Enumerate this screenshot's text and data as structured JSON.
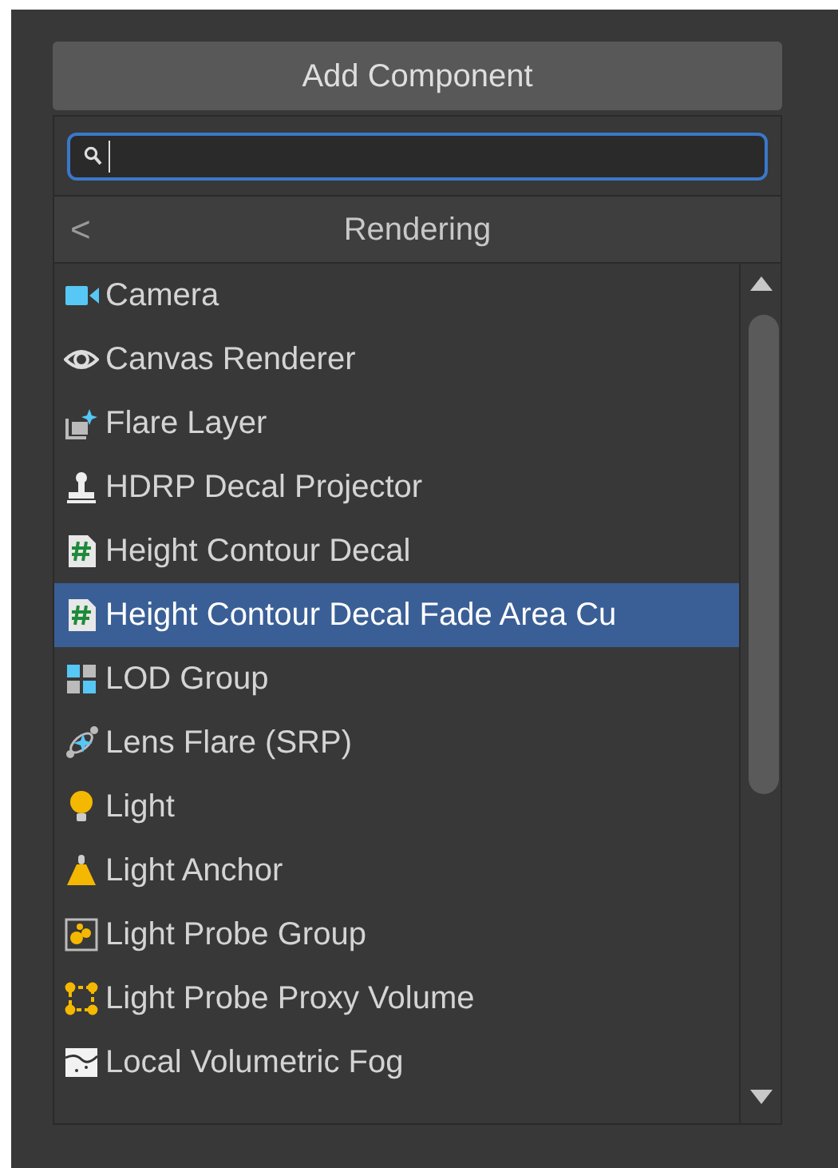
{
  "add_button": {
    "label": "Add Component"
  },
  "header": {
    "back": "<",
    "title": "Rendering"
  },
  "items": [
    {
      "label": "Camera",
      "kind": "camera",
      "selected": false
    },
    {
      "label": "Canvas Renderer",
      "kind": "eye",
      "selected": false
    },
    {
      "label": "Flare Layer",
      "kind": "layers",
      "selected": false
    },
    {
      "label": "HDRP Decal Projector",
      "kind": "stamp",
      "selected": false
    },
    {
      "label": "Height Contour Decal",
      "kind": "script",
      "selected": false
    },
    {
      "label": "Height Contour Decal Fade Area Cu",
      "kind": "script",
      "selected": true
    },
    {
      "label": "LOD Group",
      "kind": "lod",
      "selected": false
    },
    {
      "label": "Lens Flare (SRP)",
      "kind": "flare",
      "selected": false
    },
    {
      "label": "Light",
      "kind": "bulb",
      "selected": false
    },
    {
      "label": "Light Anchor",
      "kind": "anchor",
      "selected": false
    },
    {
      "label": "Light Probe Group",
      "kind": "probegroup",
      "selected": false
    },
    {
      "label": "Light Probe Proxy Volume",
      "kind": "probeproxy",
      "selected": false
    },
    {
      "label": "Local Volumetric Fog",
      "kind": "fog",
      "selected": false
    }
  ]
}
